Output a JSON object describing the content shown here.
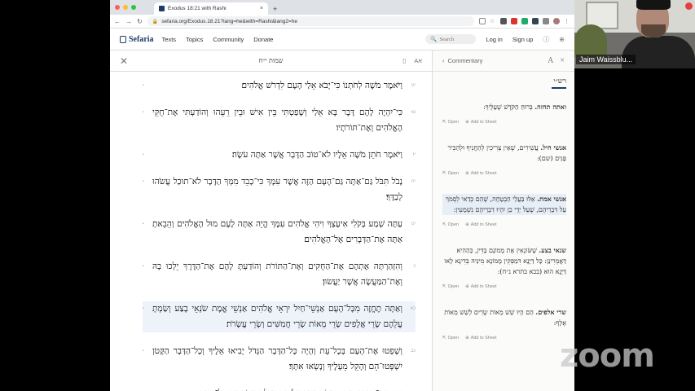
{
  "browser": {
    "tab_title": "Exodus 18:21 with Rashi",
    "tab_close": "×",
    "new_tab": "+",
    "url": "sefaria.org/Exodus.18.21?lang=he&with=Rashi&lang2=he"
  },
  "header": {
    "logo": "Sefaria",
    "nav": [
      "Texts",
      "Topics",
      "Community",
      "Donate"
    ],
    "search_placeholder": "Search",
    "login": "Log in",
    "signup": "Sign up"
  },
  "reader": {
    "title": "שמות י״ח",
    "font_toggle": "Aא",
    "verses": [
      {
        "num_he": "יט",
        "num_en": "",
        "text": "וַיֹּאמֶר מֹשֶׁה לְחֹתְנוֹ כִּי־יָבֹא אֵלַי הָעָם לִדְרֹשׁ אֱלֹהִים׃",
        "highlight": false
      },
      {
        "num_he": "טז",
        "num_en": "",
        "text": "כִּי־יִהְיֶה לָהֶם דָּבָר בָּא אֵלַי וְשָׁפַטְתִּי בֵּין אִישׁ וּבֵין רֵעֵהוּ וְהוֹדַעְתִּי אֶת־חֻקֵּי הָאֱלֹהִים וְאֶת־תּוֹרֹתָיו׃",
        "highlight": false
      },
      {
        "num_he": "יז",
        "num_en": "",
        "text": "וַיֹּאמֶר חֹתֵן מֹשֶׁה אֵלָיו לֹא־טוֹב הַדָּבָר אֲשֶׁר אַתָּה עֹשֶׂה׃",
        "highlight": false
      },
      {
        "num_he": "יח",
        "num_en": "",
        "text": "נָבֹל תִּבֹּל גַּם־אַתָּה גַּם־הָעָם הַזֶּה אֲשֶׁר עִמָּךְ כִּי־כָבֵד מִמְּךָ הַדָּבָר לֹא־תוּכַל עֲשֹׂהוּ לְבַדֶּךָ׃",
        "highlight": false
      },
      {
        "num_he": "יט",
        "num_en": "",
        "text": "עַתָּה שְׁמַע בְּקֹלִי אִיעָצְךָ וִיהִי אֱלֹהִים עִמָּךְ הֱיֵה אַתָּה לָעָם מוּל הָאֱלֹהִים וְהֵבֵאתָ אַתָּה אֶת־הַדְּבָרִים אֶל־הָאֱלֹהִים׃",
        "highlight": false
      },
      {
        "num_he": "כ",
        "num_en": "",
        "text": "וְהִזְהַרְתָּה אֶתְהֶם אֶת־הַחֻקִּים וְאֶת־הַתּוֹרֹת וְהוֹדַעְתָּ לָהֶם אֶת־הַדֶּרֶךְ יֵלְכוּ בָהּ וְאֶת־הַמַּעֲשֶׂה אֲשֶׁר יַעֲשׂוּן׃",
        "highlight": false
      },
      {
        "num_he": "כא",
        "num_en": "",
        "text": "וְאַתָּה תֶחֱזֶה מִכָּל־הָעָם אַנְשֵׁי־חַיִל יִרְאֵי אֱלֹהִים אַנְשֵׁי אֱמֶת שֹׂנְאֵי בָצַע וְשַׂמְתָּ עֲלֵהֶם שָׂרֵי אֲלָפִים שָׂרֵי מֵאוֹת שָׂרֵי חֲמִשִּׁים וְשָׂרֵי עֲשָׂרֹת׃",
        "highlight": true
      },
      {
        "num_he": "כב",
        "num_en": "",
        "text": "וְשָׁפְטוּ אֶת־הָעָם בְּכָל־עֵת וְהָיָה כָּל־הַדָּבָר הַגָּדֹל יָבִיאוּ אֵלֶיךָ וְכָל־הַדָּבָר הַקָּטֹן יִשְׁפְּטוּ־הֵם וְהָקֵל מֵעָלֶיךָ וְנָשְׂאוּ אִתָּךְ׃",
        "highlight": false
      },
      {
        "num_he": "כג",
        "num_en": "",
        "text": "אִם אֶת־הַדָּבָר הַזֶּה תַּעֲשֶׂה וְצִוְּךָ אֱלֹהִים וְיָכָלְתָּ עֲמֹד וְגַם כָּל־הָעָם",
        "highlight": false
      }
    ]
  },
  "commentary": {
    "back_label": "Commentary",
    "font_label": "A",
    "close": "×",
    "tab": "רש״י",
    "open_label": "Open",
    "add_label": "Add to Sheet",
    "items": [
      {
        "dh": "ואתה תחזה.",
        "text": "בְּרוּחַ הַקֹּדֶשׁ שֶׁעָלֶיךָ:",
        "highlight": false
      },
      {
        "dh": "אנשי חיל.",
        "text": "עֲשִׁירִים, שֶׁאֵין צְרִיכִין לְהַחֲנִיף וּלְהַכִּיר פָּנִים (שם):",
        "highlight": false
      },
      {
        "dh": "אנשי אמת.",
        "text": "אֵלּוּ בַּעֲלֵי הַבְטָחָה, שֶׁהֵם כְּדַאי לִסְמֹךְ עַל דִּבְרֵיהֶם, שֶׁעַל יְדֵי כֵן יִהְיוּ דִבְרֵיהֶם נִשְׁמָעִין:",
        "highlight": true
      },
      {
        "dh": "שנאי בצע.",
        "text": "שֶׁשּׂוֹנְאִין אֶת מָמוֹנָם בַּדִּין, כְּהַהִיא דַּאֲמְרִינַן: כָּל דַּיָּנָא דִּמַפְּקִין מָמוֹנָא מִינֵּיהּ בְּדִינָא לָאו דַּיָּנָא הוּא (בבא בתרא נ״ח):",
        "highlight": false
      },
      {
        "dh": "שרי אלפים.",
        "text": "הֵם הָיוּ שֵׁשׁ מֵאוֹת שָׂרִים לְשֵׁשׁ מֵאוֹת אֶלֶף:",
        "highlight": false
      }
    ]
  },
  "video": {
    "participant_name": "Jaim Waissblu..."
  },
  "watermark": "zoom",
  "colors": {
    "brand": "#1c3b67",
    "highlight": "#eef3fb"
  }
}
